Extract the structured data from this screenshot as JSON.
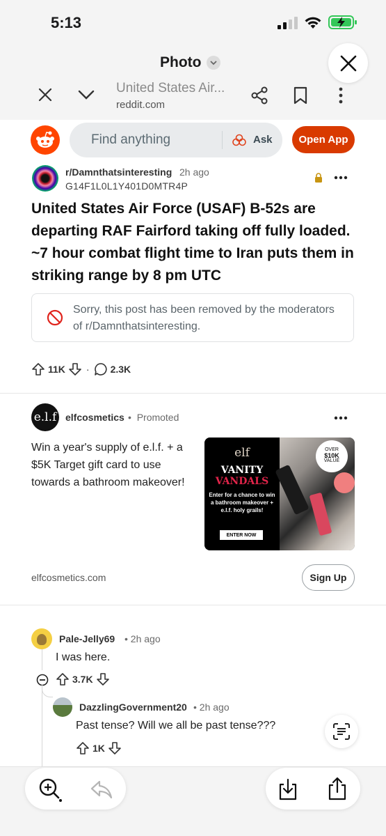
{
  "status_bar": {
    "time": "5:13"
  },
  "photo_header": {
    "title": "Photo"
  },
  "browser": {
    "site_title": "United States Air...",
    "domain": "reddit.com"
  },
  "reddit_header": {
    "search_placeholder": "Find anything",
    "ask_label": "Ask",
    "open_app_label": "Open App",
    "brand_color": "#d93a00"
  },
  "post": {
    "subreddit": "r/Damnthatsinteresting",
    "time": "2h ago",
    "author": "G14F1L0L1Y401D0MTR4P",
    "title": "United States Air Force (USAF) B-52s are departing RAF Fairford taking off fully loaded. ~7 hour combat flight time to Iran puts them in striking range by 8 pm UTC",
    "removed_notice": "Sorry, this post has been removed by the moderators of r/Damnthatsinteresting.",
    "upvotes": "11K",
    "separator": "·",
    "comments": "2.3K"
  },
  "ad": {
    "logo_text": "e.l.f",
    "advertiser": "elfcosmetics",
    "promoted_label": "Promoted",
    "text": "Win a year's supply of e.l.f. + a $5K Target gift card to use towards a bathroom makeover!",
    "image": {
      "brand": "elf",
      "headline_line1": "VANITY",
      "headline_line2": "VANDALS",
      "small_text": "Enter for a chance to win a bathroom makeover + e.l.f. holy grails!",
      "cta": "ENTER NOW",
      "badge_top": "OVER",
      "badge_amount": "$10K",
      "badge_bottom": "VALUE"
    },
    "domain": "elfcosmetics.com",
    "signup_label": "Sign Up"
  },
  "comments": [
    {
      "user": "Pale-Jelly69",
      "time": "2h ago",
      "body": "I was here.",
      "votes": "3.7K"
    },
    {
      "user": "DazzlingGovernment20",
      "time": "2h ago",
      "body": "Past tense? Will we all be past tense???",
      "votes": "1K"
    }
  ],
  "dot_sep": "•"
}
